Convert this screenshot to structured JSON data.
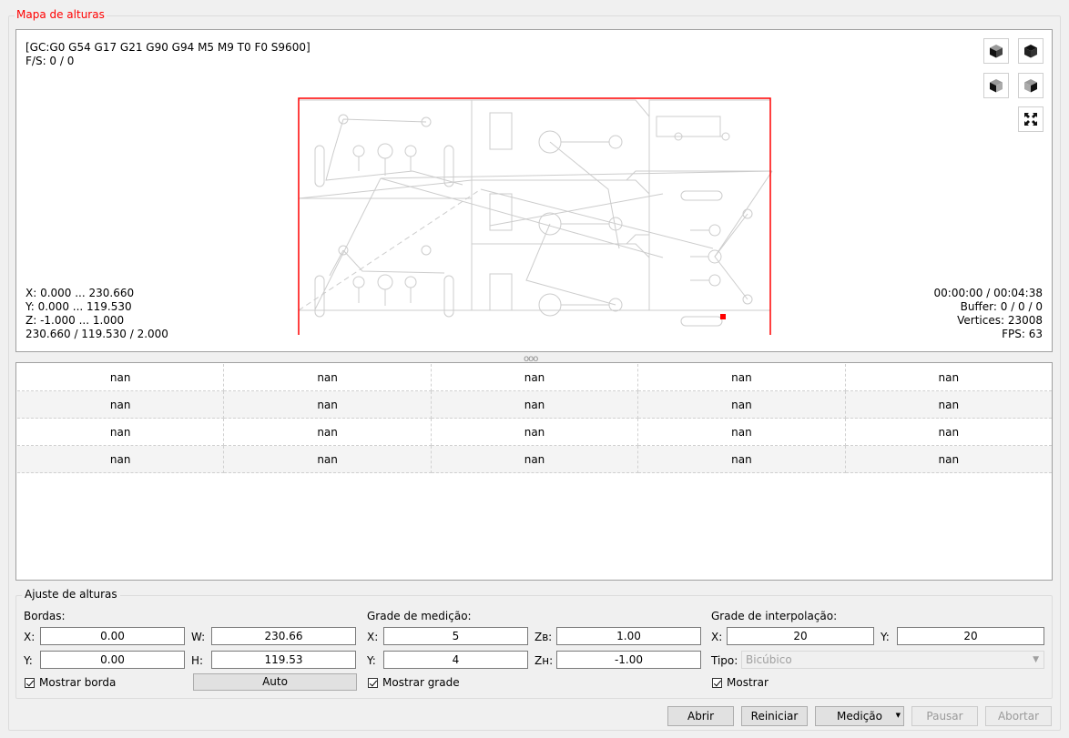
{
  "heightmap": {
    "group_title": "Mapa de alturas",
    "gcode_state": "[GC:G0 G54 G17 G21 G90 G94 M5 M9 T0 F0 S9600]",
    "feed_speed": "F/S: 0 / 0",
    "range_x": "X: 0.000 ... 230.660",
    "range_y": "Y: 0.000 ... 119.530",
    "range_z": "Z: -1.000 ... 1.000",
    "size": "230.660 / 119.530 / 2.000",
    "time": "00:00:00 / 00:04:38",
    "buffer": "Buffer: 0 / 0 / 0",
    "vertices": "Vertices: 23008",
    "fps": "FPS: 63",
    "splitter": "ooo"
  },
  "view_buttons": {
    "icons": [
      "view-iso-icon",
      "view-top-icon",
      "view-front-icon",
      "view-left-icon",
      "fit-view-icon"
    ]
  },
  "table": {
    "rows": [
      [
        "nan",
        "nan",
        "nan",
        "nan",
        "nan"
      ],
      [
        "nan",
        "nan",
        "nan",
        "nan",
        "nan"
      ],
      [
        "nan",
        "nan",
        "nan",
        "nan",
        "nan"
      ],
      [
        "nan",
        "nan",
        "nan",
        "nan",
        "nan"
      ]
    ]
  },
  "adjust": {
    "title": "Ajuste de alturas",
    "borders": {
      "label": "Bordas:",
      "x_label": "X:",
      "x": "0.00",
      "y_label": "Y:",
      "y": "0.00",
      "w_label": "W:",
      "w": "230.66",
      "h_label": "H:",
      "h": "119.53",
      "show_label": "Mostrar borda",
      "auto_label": "Auto"
    },
    "probe_grid": {
      "label": "Grade de medição:",
      "x_label": "X:",
      "x": "5",
      "y_label": "Y:",
      "y": "4",
      "zb_label": "Zʙ:",
      "zb": "1.00",
      "zh_label": "Zʜ:",
      "zh": "-1.00",
      "show_label": "Mostrar grade"
    },
    "interp_grid": {
      "label": "Grade de interpolação:",
      "x_label": "X:",
      "x": "20",
      "y_label": "Y:",
      "y": "20",
      "type_label": "Tipo:",
      "type": "Bicúbico",
      "show_label": "Mostrar"
    }
  },
  "buttons": {
    "open": "Abrir",
    "reset": "Reiniciar",
    "probe": "Medição",
    "pause": "Pausar",
    "abort": "Abortar"
  },
  "colors": {
    "title": "#ff0000",
    "border": "#ff0000",
    "drawing": "#cccccc",
    "tool": "#f2a61b"
  }
}
